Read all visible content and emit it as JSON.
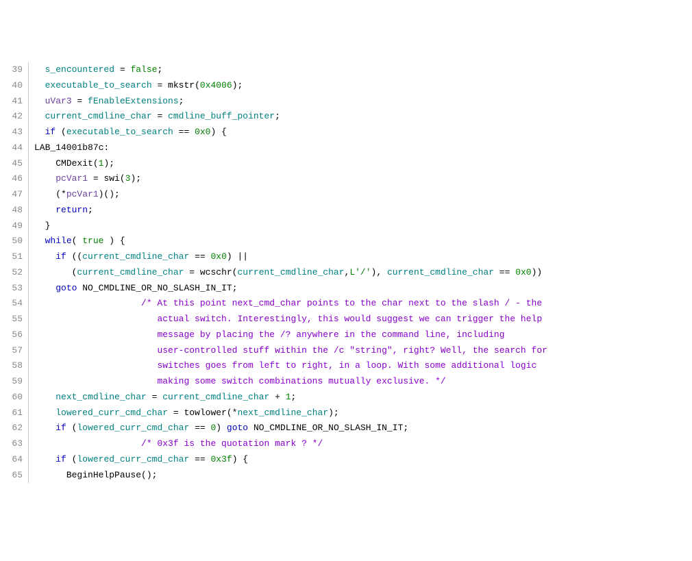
{
  "lines": [
    {
      "num": "39",
      "tokens": [
        {
          "txt": "  ",
          "cls": "t-default"
        },
        {
          "txt": "s_encountered",
          "cls": "t-ident"
        },
        {
          "txt": " = ",
          "cls": "t-punc"
        },
        {
          "txt": "false",
          "cls": "t-num"
        },
        {
          "txt": ";",
          "cls": "t-punc"
        }
      ]
    },
    {
      "num": "40",
      "tokens": [
        {
          "txt": "  ",
          "cls": "t-default"
        },
        {
          "txt": "executable_to_search",
          "cls": "t-ident"
        },
        {
          "txt": " = ",
          "cls": "t-punc"
        },
        {
          "txt": "mkstr",
          "cls": "t-call"
        },
        {
          "txt": "(",
          "cls": "t-punc"
        },
        {
          "txt": "0x4006",
          "cls": "t-num"
        },
        {
          "txt": ");",
          "cls": "t-punc"
        }
      ]
    },
    {
      "num": "41",
      "tokens": [
        {
          "txt": "  ",
          "cls": "t-default"
        },
        {
          "txt": "uVar3",
          "cls": "t-ident2"
        },
        {
          "txt": " = ",
          "cls": "t-punc"
        },
        {
          "txt": "fEnableExtensions",
          "cls": "t-ident"
        },
        {
          "txt": ";",
          "cls": "t-punc"
        }
      ]
    },
    {
      "num": "42",
      "tokens": [
        {
          "txt": "  ",
          "cls": "t-default"
        },
        {
          "txt": "current_cmdline_char",
          "cls": "t-ident"
        },
        {
          "txt": " = ",
          "cls": "t-punc"
        },
        {
          "txt": "cmdline_buff_pointer",
          "cls": "t-ident"
        },
        {
          "txt": ";",
          "cls": "t-punc"
        }
      ]
    },
    {
      "num": "43",
      "tokens": [
        {
          "txt": "  ",
          "cls": "t-default"
        },
        {
          "txt": "if",
          "cls": "t-keyword"
        },
        {
          "txt": " (",
          "cls": "t-punc"
        },
        {
          "txt": "executable_to_search",
          "cls": "t-ident"
        },
        {
          "txt": " == ",
          "cls": "t-punc"
        },
        {
          "txt": "0x0",
          "cls": "t-num"
        },
        {
          "txt": ") {",
          "cls": "t-punc"
        }
      ]
    },
    {
      "num": "44",
      "tokens": [
        {
          "txt": "LAB_14001b87c",
          "cls": "t-label"
        },
        {
          "txt": ":",
          "cls": "t-punc"
        }
      ]
    },
    {
      "num": "45",
      "tokens": [
        {
          "txt": "    ",
          "cls": "t-default"
        },
        {
          "txt": "CMDexit",
          "cls": "t-call"
        },
        {
          "txt": "(",
          "cls": "t-punc"
        },
        {
          "txt": "1",
          "cls": "t-num"
        },
        {
          "txt": ");",
          "cls": "t-punc"
        }
      ]
    },
    {
      "num": "46",
      "tokens": [
        {
          "txt": "    ",
          "cls": "t-default"
        },
        {
          "txt": "pcVar1",
          "cls": "t-ident2"
        },
        {
          "txt": " = ",
          "cls": "t-punc"
        },
        {
          "txt": "swi",
          "cls": "t-call"
        },
        {
          "txt": "(",
          "cls": "t-punc"
        },
        {
          "txt": "3",
          "cls": "t-num"
        },
        {
          "txt": ");",
          "cls": "t-punc"
        }
      ]
    },
    {
      "num": "47",
      "tokens": [
        {
          "txt": "    (*",
          "cls": "t-punc"
        },
        {
          "txt": "pcVar1",
          "cls": "t-ident2"
        },
        {
          "txt": ")();",
          "cls": "t-punc"
        }
      ]
    },
    {
      "num": "48",
      "tokens": [
        {
          "txt": "    ",
          "cls": "t-default"
        },
        {
          "txt": "return",
          "cls": "t-keyword"
        },
        {
          "txt": ";",
          "cls": "t-punc"
        }
      ]
    },
    {
      "num": "49",
      "tokens": [
        {
          "txt": "  }",
          "cls": "t-punc"
        }
      ]
    },
    {
      "num": "50",
      "tokens": [
        {
          "txt": "  ",
          "cls": "t-default"
        },
        {
          "txt": "while",
          "cls": "t-keyword"
        },
        {
          "txt": "( ",
          "cls": "t-punc"
        },
        {
          "txt": "true",
          "cls": "t-num"
        },
        {
          "txt": " ) {",
          "cls": "t-punc"
        }
      ]
    },
    {
      "num": "51",
      "tokens": [
        {
          "txt": "    ",
          "cls": "t-default"
        },
        {
          "txt": "if",
          "cls": "t-keyword"
        },
        {
          "txt": " ((",
          "cls": "t-punc"
        },
        {
          "txt": "current_cmdline_char",
          "cls": "t-ident"
        },
        {
          "txt": " == ",
          "cls": "t-punc"
        },
        {
          "txt": "0x0",
          "cls": "t-num"
        },
        {
          "txt": ") ||",
          "cls": "t-punc"
        }
      ]
    },
    {
      "num": "52",
      "tokens": [
        {
          "txt": "       (",
          "cls": "t-punc"
        },
        {
          "txt": "current_cmdline_char",
          "cls": "t-ident"
        },
        {
          "txt": " = ",
          "cls": "t-punc"
        },
        {
          "txt": "wcschr",
          "cls": "t-call"
        },
        {
          "txt": "(",
          "cls": "t-punc"
        },
        {
          "txt": "current_cmdline_char",
          "cls": "t-ident"
        },
        {
          "txt": ",",
          "cls": "t-punc"
        },
        {
          "txt": "L'/'",
          "cls": "t-str"
        },
        {
          "txt": "), ",
          "cls": "t-punc"
        },
        {
          "txt": "current_cmdline_char",
          "cls": "t-ident"
        },
        {
          "txt": " == ",
          "cls": "t-punc"
        },
        {
          "txt": "0x0",
          "cls": "t-num"
        },
        {
          "txt": "))",
          "cls": "t-punc"
        }
      ]
    },
    {
      "num": "53",
      "tokens": [
        {
          "txt": "    ",
          "cls": "t-default"
        },
        {
          "txt": "goto",
          "cls": "t-keyword"
        },
        {
          "txt": " ",
          "cls": "t-punc"
        },
        {
          "txt": "NO_CMDLINE_OR_NO_SLASH_IN_IT",
          "cls": "t-label"
        },
        {
          "txt": ";",
          "cls": "t-punc"
        }
      ]
    },
    {
      "num": "54",
      "tokens": [
        {
          "txt": "                    ",
          "cls": "t-default"
        },
        {
          "txt": "/* At this point next_cmd_char points to the char next to the slash / - the",
          "cls": "t-comment"
        }
      ]
    },
    {
      "num": "55",
      "tokens": [
        {
          "txt": "                       ",
          "cls": "t-default"
        },
        {
          "txt": "actual switch. Interestingly, this would suggest we can trigger the help",
          "cls": "t-comment"
        }
      ]
    },
    {
      "num": "56",
      "tokens": [
        {
          "txt": "                       ",
          "cls": "t-default"
        },
        {
          "txt": "message by placing the /? anywhere in the command line, including",
          "cls": "t-comment"
        }
      ]
    },
    {
      "num": "57",
      "tokens": [
        {
          "txt": "                       ",
          "cls": "t-default"
        },
        {
          "txt": "user-controlled stuff within the /c \"string\", right? Well, the search for",
          "cls": "t-comment"
        }
      ]
    },
    {
      "num": "58",
      "tokens": [
        {
          "txt": "                       ",
          "cls": "t-default"
        },
        {
          "txt": "switches goes from left to right, in a loop. With some additional logic",
          "cls": "t-comment"
        }
      ]
    },
    {
      "num": "59",
      "tokens": [
        {
          "txt": "                       ",
          "cls": "t-default"
        },
        {
          "txt": "making some switch combinations mutually exclusive. */",
          "cls": "t-comment"
        }
      ]
    },
    {
      "num": "60",
      "tokens": [
        {
          "txt": "    ",
          "cls": "t-default"
        },
        {
          "txt": "next_cmdline_char",
          "cls": "t-ident"
        },
        {
          "txt": " = ",
          "cls": "t-punc"
        },
        {
          "txt": "current_cmdline_char",
          "cls": "t-ident"
        },
        {
          "txt": " + ",
          "cls": "t-punc"
        },
        {
          "txt": "1",
          "cls": "t-num"
        },
        {
          "txt": ";",
          "cls": "t-punc"
        }
      ]
    },
    {
      "num": "61",
      "tokens": [
        {
          "txt": "    ",
          "cls": "t-default"
        },
        {
          "txt": "lowered_curr_cmd_char",
          "cls": "t-ident"
        },
        {
          "txt": " = ",
          "cls": "t-punc"
        },
        {
          "txt": "towlower",
          "cls": "t-call"
        },
        {
          "txt": "(*",
          "cls": "t-punc"
        },
        {
          "txt": "next_cmdline_char",
          "cls": "t-ident"
        },
        {
          "txt": ");",
          "cls": "t-punc"
        }
      ]
    },
    {
      "num": "62",
      "tokens": [
        {
          "txt": "    ",
          "cls": "t-default"
        },
        {
          "txt": "if",
          "cls": "t-keyword"
        },
        {
          "txt": " (",
          "cls": "t-punc"
        },
        {
          "txt": "lowered_curr_cmd_char",
          "cls": "t-ident"
        },
        {
          "txt": " == ",
          "cls": "t-punc"
        },
        {
          "txt": "0",
          "cls": "t-num"
        },
        {
          "txt": ") ",
          "cls": "t-punc"
        },
        {
          "txt": "goto",
          "cls": "t-keyword"
        },
        {
          "txt": " ",
          "cls": "t-punc"
        },
        {
          "txt": "NO_CMDLINE_OR_NO_SLASH_IN_IT",
          "cls": "t-label"
        },
        {
          "txt": ";",
          "cls": "t-punc"
        }
      ]
    },
    {
      "num": "63",
      "tokens": [
        {
          "txt": "                    ",
          "cls": "t-default"
        },
        {
          "txt": "/* 0x3f is the quotation mark ? */",
          "cls": "t-comment"
        }
      ]
    },
    {
      "num": "64",
      "tokens": [
        {
          "txt": "    ",
          "cls": "t-default"
        },
        {
          "txt": "if",
          "cls": "t-keyword"
        },
        {
          "txt": " (",
          "cls": "t-punc"
        },
        {
          "txt": "lowered_curr_cmd_char",
          "cls": "t-ident"
        },
        {
          "txt": " == ",
          "cls": "t-punc"
        },
        {
          "txt": "0x3f",
          "cls": "t-num"
        },
        {
          "txt": ") {",
          "cls": "t-punc"
        }
      ]
    },
    {
      "num": "65",
      "tokens": [
        {
          "txt": "      ",
          "cls": "t-default"
        },
        {
          "txt": "BeginHelpPause",
          "cls": "t-call"
        },
        {
          "txt": "();",
          "cls": "t-punc"
        }
      ]
    }
  ]
}
